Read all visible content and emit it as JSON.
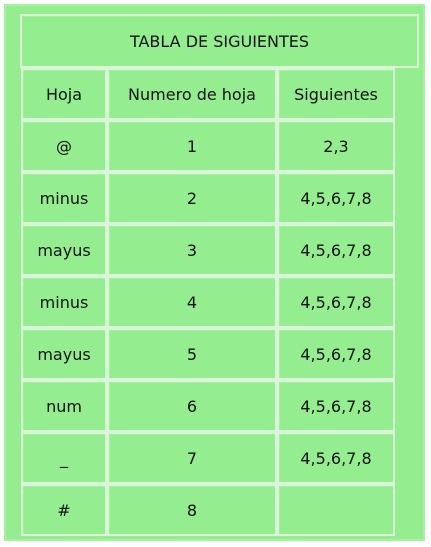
{
  "table": {
    "title": "TABLA DE SIGUIENTES",
    "headers": [
      "Hoja",
      "Numero de hoja",
      "Siguientes"
    ],
    "rows": [
      {
        "hoja": "@",
        "numero": "1",
        "siguientes": "2,3"
      },
      {
        "hoja": "minus",
        "numero": "2",
        "siguientes": "4,5,6,7,8"
      },
      {
        "hoja": "mayus",
        "numero": "3",
        "siguientes": "4,5,6,7,8"
      },
      {
        "hoja": "minus",
        "numero": "4",
        "siguientes": "4,5,6,7,8"
      },
      {
        "hoja": "mayus",
        "numero": "5",
        "siguientes": "4,5,6,7,8"
      },
      {
        "hoja": "num",
        "numero": "6",
        "siguientes": "4,5,6,7,8"
      },
      {
        "hoja": "_",
        "numero": "7",
        "siguientes": "4,5,6,7,8"
      },
      {
        "hoja": "#",
        "numero": "8",
        "siguientes": ""
      }
    ]
  },
  "colors": {
    "cell_fill": "#94ee8f",
    "cell_border": "#d9f7d6",
    "text": "#111111"
  }
}
